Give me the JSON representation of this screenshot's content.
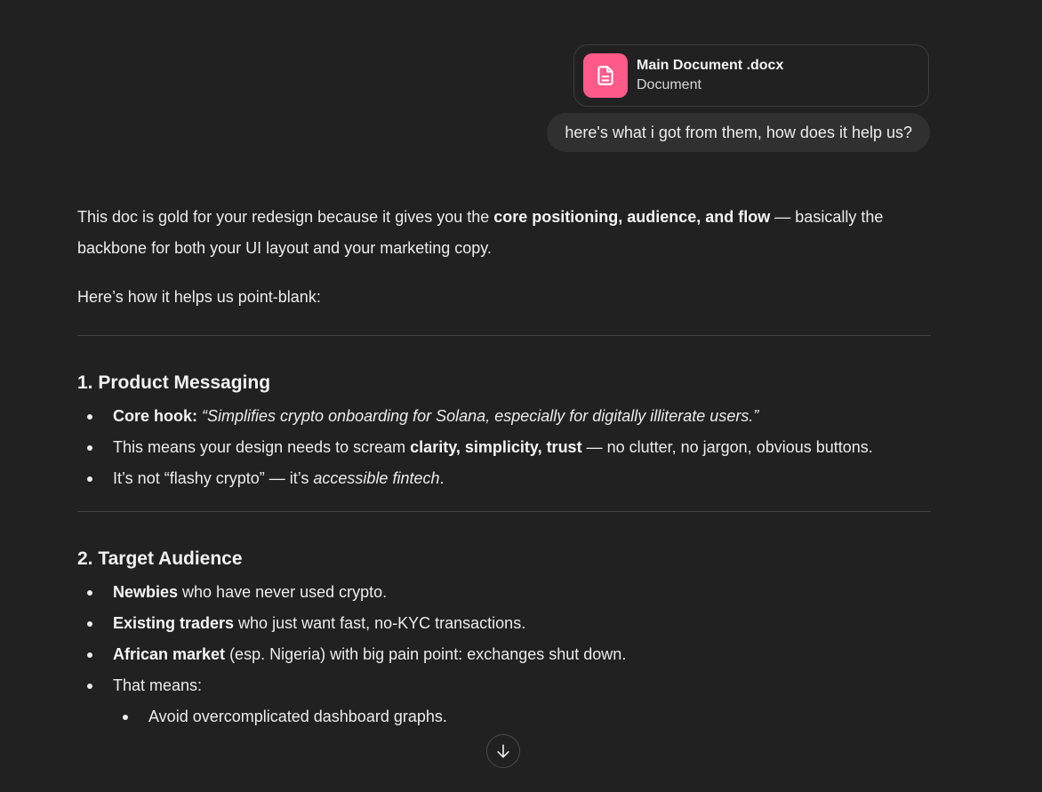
{
  "attachment": {
    "name": "Main Document .docx",
    "type": "Document",
    "icon": "document-icon",
    "icon_color": "#ff5a8a"
  },
  "user_message": "here's what i got from them, how does it help us?",
  "assistant": {
    "intro": {
      "before": "This doc is gold for your redesign because it gives you the ",
      "bold": "core positioning, audience, and flow",
      "after": " — basically the backbone for both your UI layout and your marketing copy."
    },
    "intro2": "Here’s how it helps us point-blank:",
    "sections": [
      {
        "heading": "1. Product Messaging",
        "bullets": [
          {
            "bold": "Core hook:",
            "italic": "“Simplifies crypto onboarding for Solana, especially for digitally illiterate users.”"
          },
          {
            "before": "This means your design needs to scream ",
            "bold": "clarity, simplicity, trust",
            "after": " — no clutter, no jargon, obvious buttons."
          },
          {
            "before": "It’s not “flashy crypto” — it’s ",
            "italic": "accessible fintech",
            "after": "."
          }
        ]
      },
      {
        "heading": "2. Target Audience",
        "bullets": [
          {
            "bold": "Newbies",
            "after": " who have never used crypto."
          },
          {
            "bold": "Existing traders",
            "after": " who just want fast, no-KYC transactions."
          },
          {
            "bold": "African market",
            "after": " (esp. Nigeria) with big pain point: exchanges shut down."
          },
          {
            "before": "That means:"
          }
        ],
        "sub_bullets": [
          "Avoid overcomplicated dashboard graphs."
        ]
      }
    ]
  },
  "scroll_button": {
    "icon": "arrow-down-icon"
  },
  "colors": {
    "background": "#212121",
    "bubble": "#303030",
    "text": "#ececec",
    "divider": "#444444"
  }
}
